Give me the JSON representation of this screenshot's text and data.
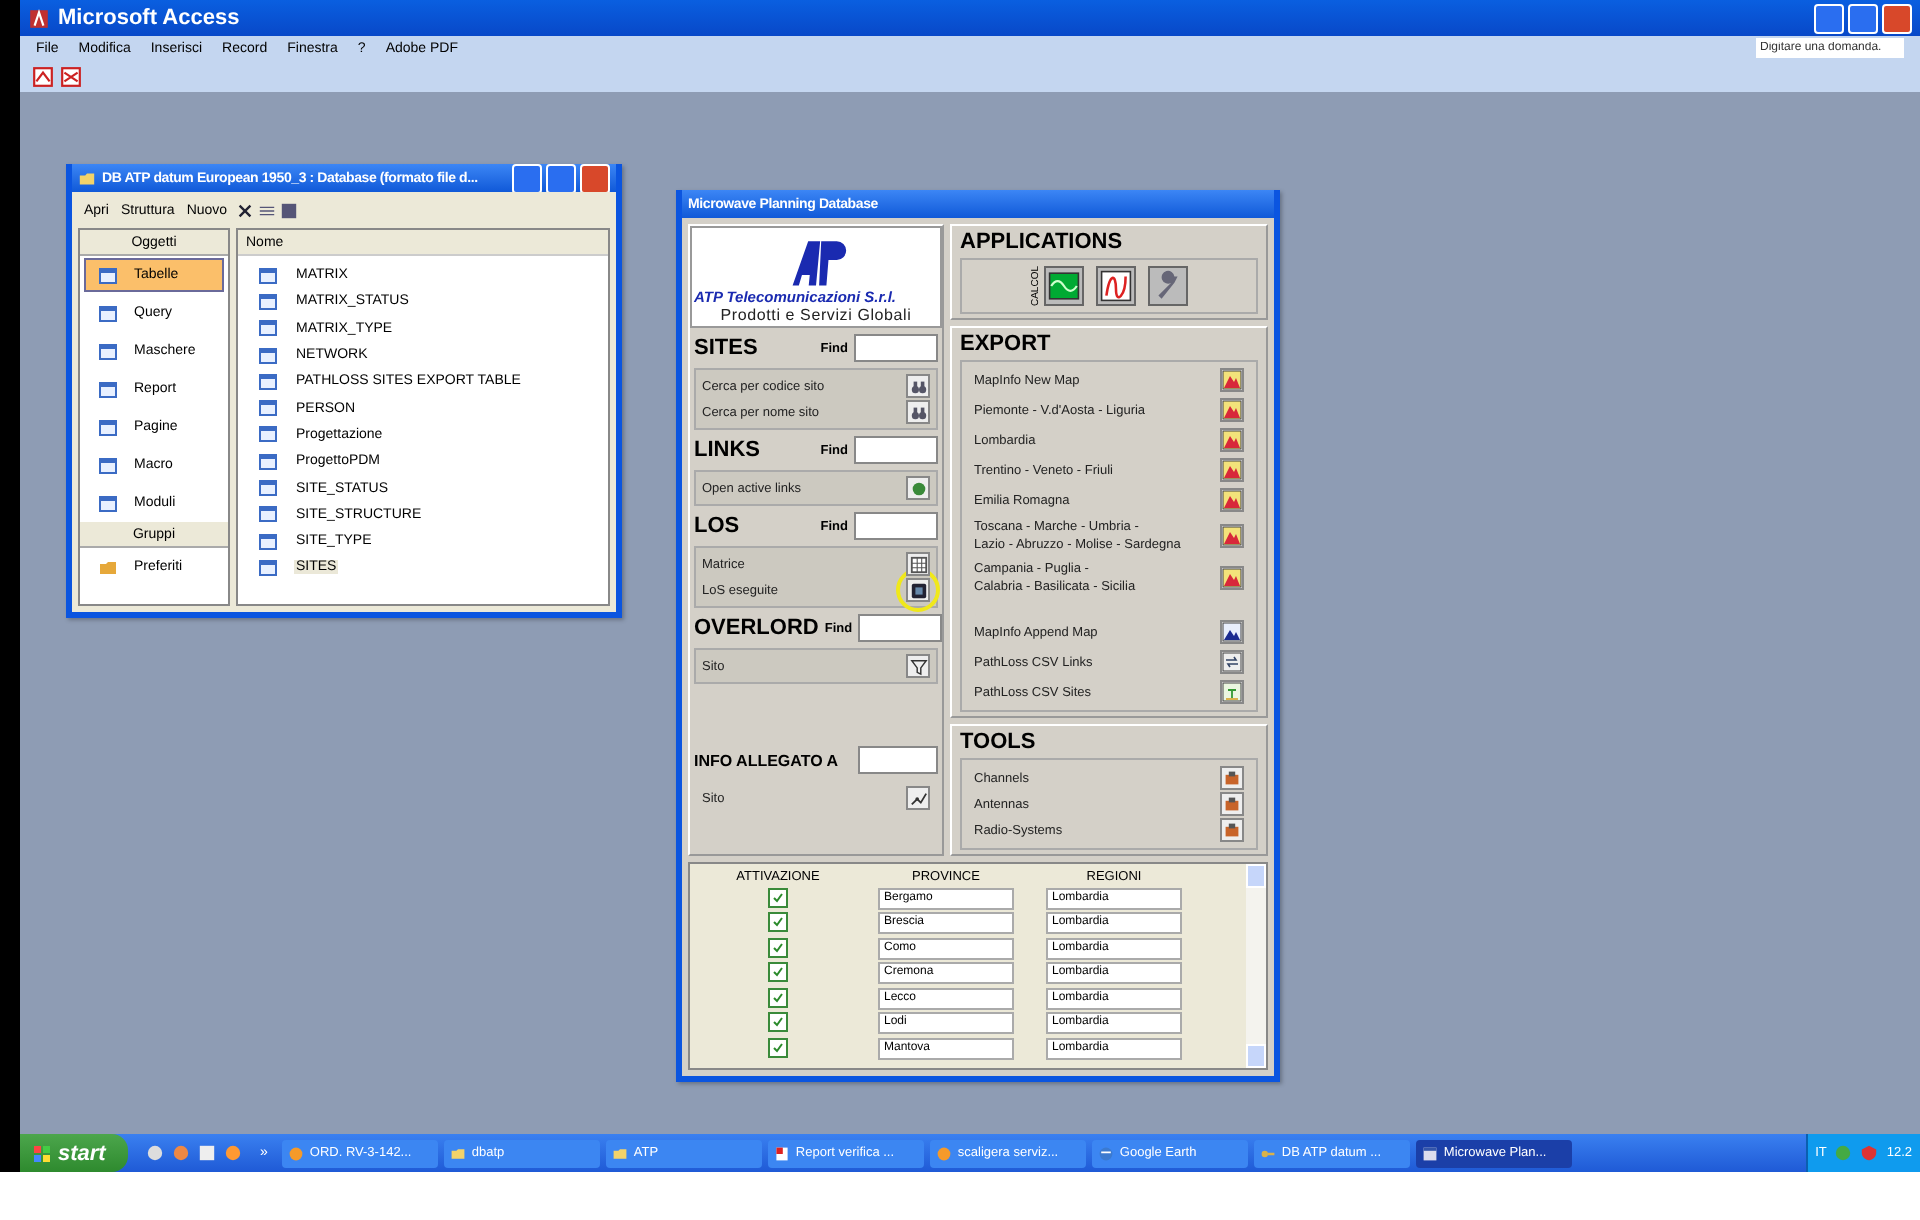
{
  "app": {
    "title": "Microsoft Access",
    "menu": [
      "File",
      "Modifica",
      "Inserisci",
      "Record",
      "Finestra",
      "?",
      "Adobe PDF"
    ],
    "help_placeholder": "Digitare una domanda."
  },
  "db_window": {
    "title": "DB ATP datum European 1950_3 : Database (formato file d...",
    "toolbar": [
      "Apri",
      "Struttura",
      "Nuovo"
    ],
    "objects_header": "Oggetti",
    "objects": [
      {
        "label": "Tabelle",
        "selected": true
      },
      {
        "label": "Query",
        "selected": false
      },
      {
        "label": "Maschere",
        "selected": false
      },
      {
        "label": "Report",
        "selected": false
      },
      {
        "label": "Pagine",
        "selected": false
      },
      {
        "label": "Macro",
        "selected": false
      },
      {
        "label": "Moduli",
        "selected": false
      }
    ],
    "groups_header": "Gruppi",
    "groups": [
      "Preferiti"
    ],
    "list_header": "Nome",
    "items": [
      {
        "label": "MATRIX",
        "selected": false
      },
      {
        "label": "MATRIX_STATUS",
        "selected": false
      },
      {
        "label": "MATRIX_TYPE",
        "selected": false
      },
      {
        "label": "NETWORK",
        "selected": false
      },
      {
        "label": "PATHLOSS SITES EXPORT TABLE",
        "selected": false
      },
      {
        "label": "PERSON",
        "selected": false
      },
      {
        "label": "Progettazione",
        "selected": false
      },
      {
        "label": "ProgettoPDM",
        "selected": false
      },
      {
        "label": "SITE_STATUS",
        "selected": false
      },
      {
        "label": "SITE_STRUCTURE",
        "selected": false
      },
      {
        "label": "SITE_TYPE",
        "selected": false
      },
      {
        "label": "SITES",
        "selected": true
      }
    ]
  },
  "form": {
    "title": "Microwave Planning Database",
    "logo": {
      "company": "ATP Telecomunicazioni S.r.l.",
      "tagline": "Prodotti e Servizi Globali"
    },
    "sections": [
      {
        "heading": "SITES",
        "find": "Find",
        "rows": [
          {
            "label": "Cerca per codice sito",
            "kind": "binoculars",
            "highlighted": false
          },
          {
            "label": "Cerca per nome sito",
            "kind": "binoculars",
            "highlighted": false
          }
        ]
      },
      {
        "heading": "LINKS",
        "find": "Find",
        "rows": [
          {
            "label": "Open active links",
            "kind": "dot",
            "highlighted": false
          }
        ]
      },
      {
        "heading": "LOS",
        "find": "Find",
        "rows": [
          {
            "label": "Matrice",
            "kind": "grid",
            "highlighted": false
          },
          {
            "label": "LoS eseguite",
            "kind": "dark",
            "highlighted": true
          }
        ]
      },
      {
        "heading": "OVERLORD",
        "find": "Find",
        "rows": [
          {
            "label": "Sito",
            "kind": "filter",
            "highlighted": false
          }
        ]
      },
      {
        "heading": "INFO ALLEGATO A",
        "rows": [
          {
            "label": "Sito",
            "kind": "chart",
            "highlighted": false
          }
        ]
      }
    ],
    "applications": {
      "heading": "APPLICATIONS",
      "items": [
        {
          "label": "CALCOL",
          "kind": "scope"
        },
        {
          "kind": "graph"
        },
        {
          "kind": "wrench"
        }
      ]
    },
    "export": {
      "heading": "EXPORT",
      "groups": [
        [
          {
            "lines": [
              "MapInfo New Map"
            ],
            "kind": "map"
          },
          {
            "lines": [
              "Piemonte - V.d'Aosta - Liguria"
            ],
            "kind": "map"
          },
          {
            "lines": [
              "Lombardia"
            ],
            "kind": "map"
          },
          {
            "lines": [
              "Trentino - Veneto - Friuli"
            ],
            "kind": "map"
          },
          {
            "lines": [
              "Emilia Romagna"
            ],
            "kind": "map"
          },
          {
            "lines": [
              "Toscana - Marche - Umbria -",
              "Lazio - Abruzzo - Molise - Sardegna"
            ],
            "kind": "map"
          },
          {
            "lines": [
              "Campania - Puglia -",
              "Calabria - Basilicata - Sicilia"
            ],
            "kind": "map"
          }
        ],
        [
          {
            "lines": [
              "MapInfo Append Map"
            ],
            "kind": "append"
          },
          {
            "lines": [
              "PathLoss CSV Links"
            ],
            "kind": "links"
          },
          {
            "lines": [
              "PathLoss CSV Sites"
            ],
            "kind": "island"
          }
        ]
      ]
    },
    "tools": {
      "heading": "TOOLS",
      "items": [
        "Channels",
        "Antennas",
        "Radio-Systems"
      ]
    },
    "subform": {
      "columns": [
        "ATTIVAZIONE",
        "PROVINCE",
        "REGIONI"
      ],
      "rows": [
        {
          "active": true,
          "province": "Bergamo",
          "region": "Lombardia"
        },
        {
          "active": true,
          "province": "Brescia",
          "region": "Lombardia"
        },
        {
          "active": true,
          "province": "Como",
          "region": "Lombardia"
        },
        {
          "active": true,
          "province": "Cremona",
          "region": "Lombardia"
        },
        {
          "active": true,
          "province": "Lecco",
          "region": "Lombardia"
        },
        {
          "active": true,
          "province": "Lodi",
          "region": "Lombardia"
        },
        {
          "active": true,
          "province": "Mantova",
          "region": "Lombardia"
        }
      ]
    }
  },
  "taskbar": {
    "start": "start",
    "more": "»",
    "tasks": [
      {
        "label": "ORD. RV-3-142...",
        "kind": "circle",
        "selected": false
      },
      {
        "label": "dbatp",
        "kind": "folder",
        "selected": false
      },
      {
        "label": "ATP",
        "kind": "folder",
        "selected": false
      },
      {
        "label": "Report verifica ...",
        "kind": "doc",
        "selected": false
      },
      {
        "label": "scaligera serviz...",
        "kind": "circle",
        "selected": false
      },
      {
        "label": "Google Earth",
        "kind": "globe",
        "selected": false
      },
      {
        "label": "DB ATP datum ...",
        "kind": "db",
        "selected": false
      },
      {
        "label": "Microwave Plan...",
        "kind": "form",
        "selected": true
      }
    ],
    "language": "IT",
    "clock": "12.2"
  }
}
